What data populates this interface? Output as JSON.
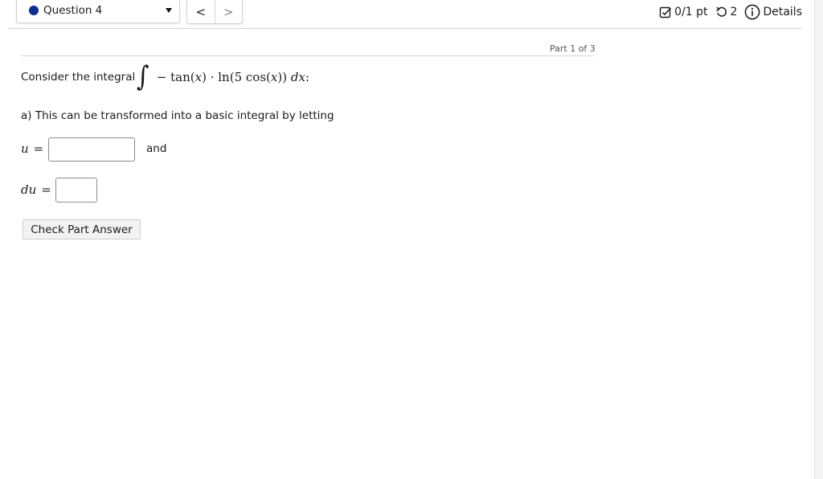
{
  "topbar": {
    "question_label": "Question 4",
    "prev_label": "<",
    "next_label": ">",
    "score": "0/1 pt",
    "retries": "2",
    "details_label": "Details",
    "icons": {
      "status_dot": "filled-circle-icon",
      "dropdown": "caret-down-icon",
      "score": "checkbox-icon",
      "retries": "retry-icon",
      "details": "info-icon"
    },
    "colors": {
      "status_dot": "#0b2e8f"
    }
  },
  "content": {
    "part_label": "Part 1 of 3",
    "prompt_text": "Consider the integral",
    "integral": {
      "sign": "∫",
      "minus": "−",
      "tan": "tan",
      "x1": "x",
      "dot": "·",
      "ln": "ln",
      "five": "5",
      "cos": "cos",
      "x2": "x",
      "d": "d",
      "x3": "x",
      "colon": ":"
    },
    "instruction": "a) This can be transformed into a basic integral by letting",
    "u_label": "u",
    "equals": "=",
    "u_value": "",
    "and_text": "and",
    "du_label": "du",
    "du_value": "",
    "check_button": "Check Part Answer"
  }
}
